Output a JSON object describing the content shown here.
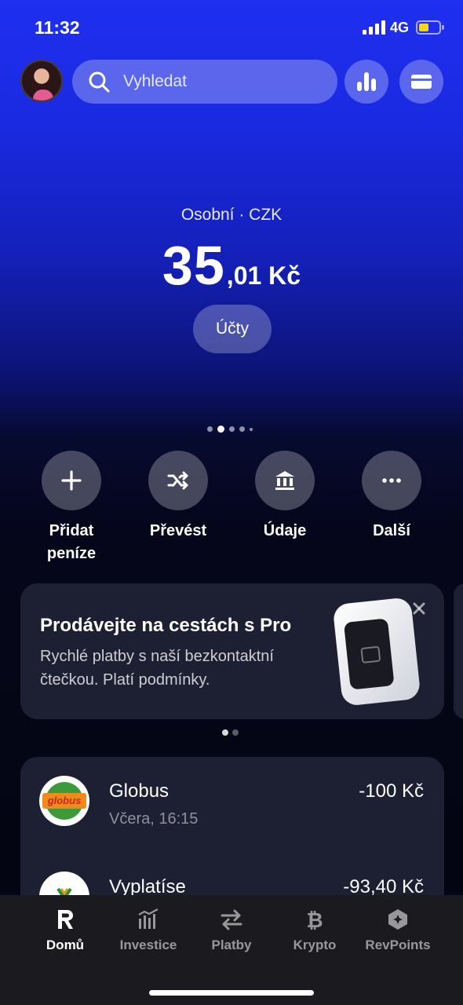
{
  "status_bar": {
    "time": "11:32",
    "network": "4G",
    "battery_color": "#f7d51a"
  },
  "header": {
    "avatar_icon": "user-avatar",
    "search_placeholder": "Vyhledat",
    "analytics_icon": "bar-chart-icon",
    "cards_icon": "card-icon"
  },
  "account": {
    "label": "Osobní · CZK",
    "balance_int": "35",
    "balance_dec": ",01 Kč",
    "accounts_button": "Účty"
  },
  "carousel": {
    "pages": 5,
    "active": 2
  },
  "actions": [
    {
      "label": "Přidat peníze",
      "icon": "plus-icon"
    },
    {
      "label": "Převést",
      "icon": "shuffle-icon"
    },
    {
      "label": "Údaje",
      "icon": "bank-icon"
    },
    {
      "label": "Další",
      "icon": "more-icon"
    }
  ],
  "promo": {
    "title": "Prodávejte na cestách s Pro",
    "description": "Rychlé platby s naší bezkontaktní čtečkou. Platí podmínky.",
    "pages": 2,
    "active": 1
  },
  "transactions": [
    {
      "name": "Globus",
      "time": "Včera, 16:15",
      "amount": "-100 Kč",
      "logo_text": "globus"
    },
    {
      "name": "Vyplatíse",
      "time": "",
      "amount": "-93,40 Kč"
    }
  ],
  "tabs": [
    {
      "label": "Domů",
      "icon": "revolut-r-icon",
      "active": true
    },
    {
      "label": "Investice",
      "icon": "chart-icon",
      "active": false
    },
    {
      "label": "Platby",
      "icon": "transfer-arrows-icon",
      "active": false
    },
    {
      "label": "Krypto",
      "icon": "bitcoin-icon",
      "active": false
    },
    {
      "label": "RevPoints",
      "icon": "revpoints-icon",
      "active": false
    }
  ]
}
